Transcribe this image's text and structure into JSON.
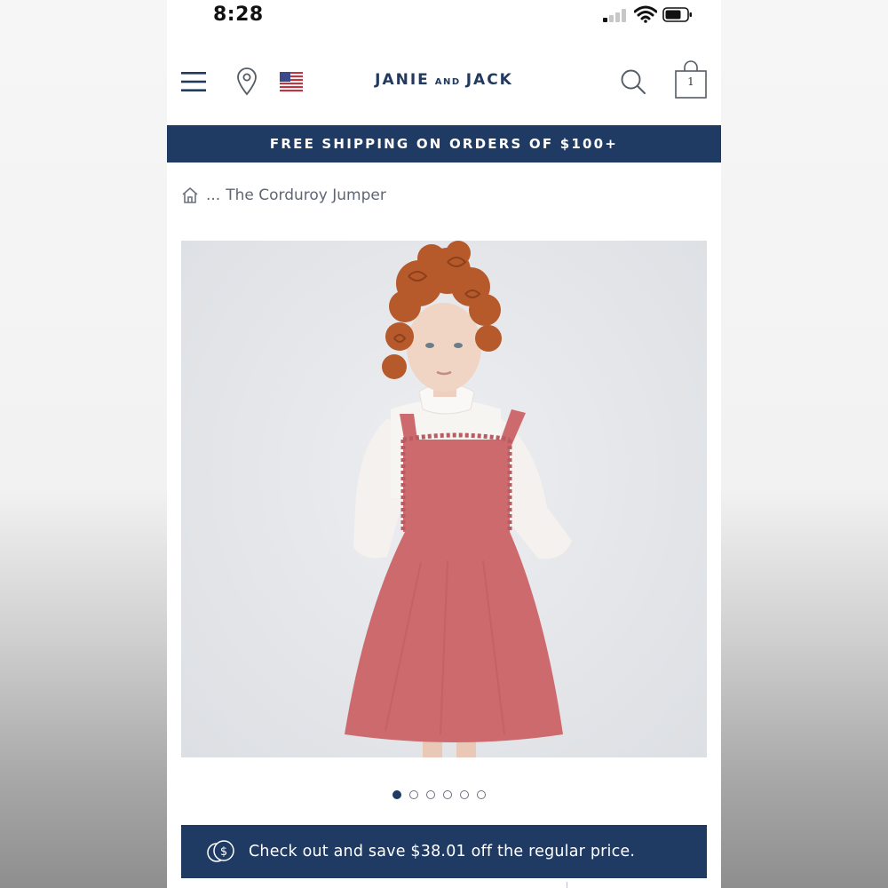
{
  "status_bar": {
    "time": "8:28"
  },
  "header": {
    "brand_left": "JANIE",
    "brand_mid": "AND",
    "brand_right": "JACK",
    "bag_count": "1",
    "icons": [
      "menu-icon",
      "location-pin-icon",
      "us-flag-icon",
      "search-icon",
      "shopping-bag-icon"
    ]
  },
  "promo": {
    "text": "FREE SHIPPING ON ORDERS OF $100+"
  },
  "breadcrumb": {
    "ellipsis": "...",
    "current": "The Corduroy Jumper"
  },
  "gallery": {
    "slide_count": 6,
    "active_slide": 1
  },
  "save_banner": {
    "text": "Check out and save $38.01 off the regular price."
  },
  "colors": {
    "navy": "#1f3b64",
    "jumper_pink": "#cd6a6e",
    "hair": "#b65a2c"
  }
}
